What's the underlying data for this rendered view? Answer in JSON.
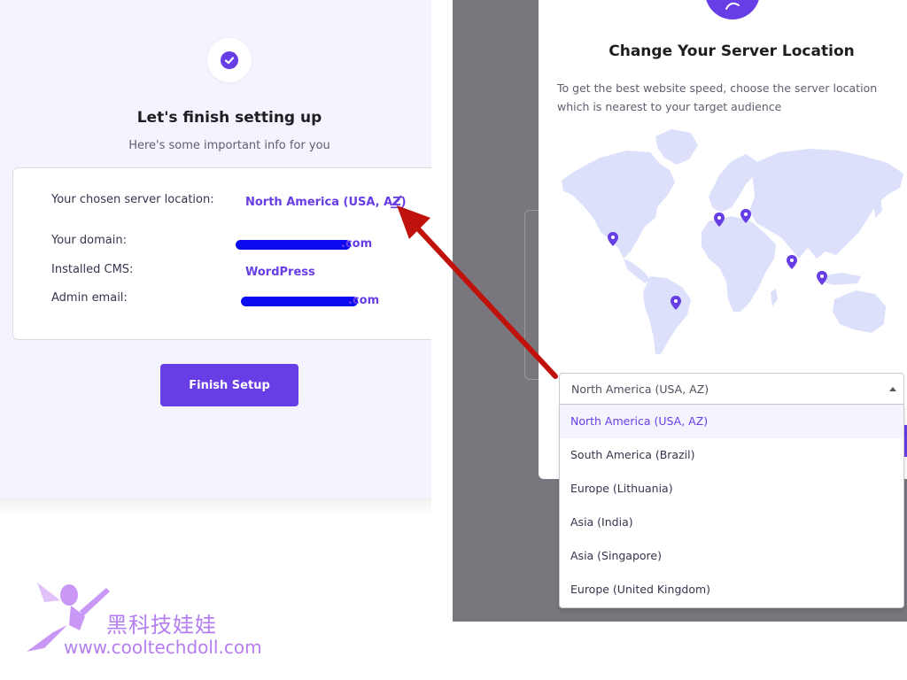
{
  "setup": {
    "title": "Let's finish setting up",
    "subtitle": "Here's some important info for you",
    "server_label": "Your chosen server location:",
    "server_value": "North America (USA, AZ)",
    "domain_label": "Your domain:",
    "domain_value_visible": ".com",
    "cms_label": "Installed CMS:",
    "cms_value": "WordPress",
    "email_label": "Admin email:",
    "email_value_visible": ".com",
    "finish_button": "Finish Setup"
  },
  "modal": {
    "title": "Change Your Server Location",
    "description": "To get the best website speed, choose the server location which is nearest to your target audience"
  },
  "location_select": {
    "selected": "North America (USA, AZ)",
    "options": [
      "North America (USA, AZ)",
      "South America (Brazil)",
      "Europe (Lithuania)",
      "Asia (India)",
      "Asia (Singapore)",
      "Europe (United Kingdom)"
    ]
  },
  "watermark": {
    "text": "黑科技娃娃",
    "url": "www.cooltechdoll.com"
  },
  "colors": {
    "accent": "#673de6",
    "panel_bg": "#f4f4ff",
    "overlay": "#79777d",
    "arrow": "#c0120c",
    "map_land": "#dde0fb",
    "watermark": "#b57ef0"
  },
  "icons": [
    "check-icon",
    "edit-pencil-icon",
    "location-pin-icon",
    "caret-up-icon"
  ]
}
